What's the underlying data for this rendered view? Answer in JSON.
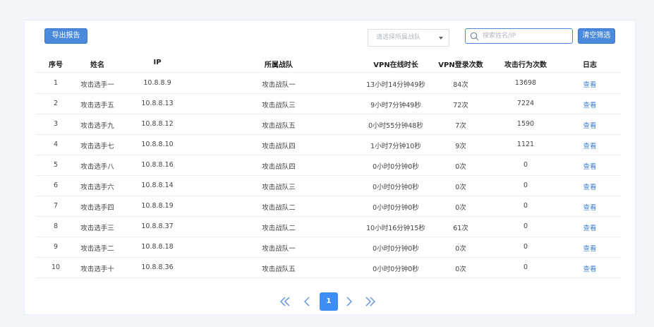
{
  "toolbar": {
    "export_label": "导出报告",
    "team_select_placeholder": "请选择所属战队",
    "search_placeholder": "搜索姓名/IP",
    "clear_label": "清空筛选"
  },
  "table": {
    "headers": [
      "序号",
      "姓名",
      "IP",
      "所属战队",
      "VPN在线时长",
      "VPN登录次数",
      "攻击行为次数",
      "日志"
    ],
    "rows": [
      [
        "1",
        "攻击选手一",
        "10.8.8.9",
        "攻击战队一",
        "13小时14分钟49秒",
        "84次",
        "13698",
        "查看"
      ],
      [
        "2",
        "攻击选手五",
        "10.8.8.13",
        "攻击战队三",
        "9小时7分钟49秒",
        "72次",
        "7224",
        "查看"
      ],
      [
        "3",
        "攻击选手九",
        "10.8.8.12",
        "攻击战队五",
        "0小时55分钟48秒",
        "7次",
        "1590",
        "查看"
      ],
      [
        "4",
        "攻击选手七",
        "10.8.8.10",
        "攻击战队四",
        "1小时7分钟10秒",
        "9次",
        "1121",
        "查看"
      ],
      [
        "5",
        "攻击选手八",
        "10.8.8.16",
        "攻击战队四",
        "0小时0分钟0秒",
        "0次",
        "0",
        "查看"
      ],
      [
        "6",
        "攻击选手六",
        "10.8.8.14",
        "攻击战队三",
        "0小时0分钟0秒",
        "0次",
        "0",
        "查看"
      ],
      [
        "7",
        "攻击选手四",
        "10.8.8.19",
        "攻击战队二",
        "0小时0分钟0秒",
        "0次",
        "0",
        "查看"
      ],
      [
        "8",
        "攻击选手三",
        "10.8.8.37",
        "攻击战队二",
        "10小时16分钟15秒",
        "61次",
        "0",
        "查看"
      ],
      [
        "9",
        "攻击选手二",
        "10.8.8.18",
        "攻击战队一",
        "0小时0分钟0秒",
        "0次",
        "0",
        "查看"
      ],
      [
        "10",
        "攻击选手十",
        "10.8.8.36",
        "攻击战队五",
        "0小时0分钟0秒",
        "0次",
        "0",
        "查看"
      ]
    ]
  },
  "pagination": {
    "current_page": "1",
    "icons": [
      "double-chevron-left-icon",
      "chevron-left-icon",
      "chevron-right-icon",
      "double-chevron-right-icon"
    ]
  },
  "colors": {
    "primary": "#4a89dc",
    "link": "#3e7fd6",
    "page_active": "#3e8ef7",
    "background": "#f2f6fb"
  }
}
